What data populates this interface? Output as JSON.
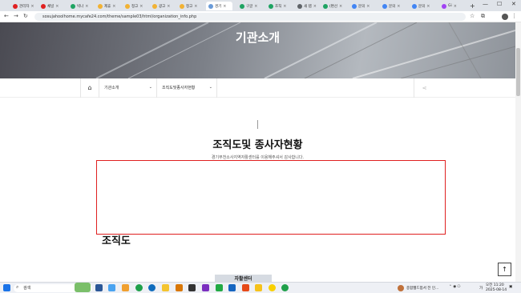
{
  "tabs": [
    {
      "label": "관리자",
      "color": "#e02020"
    },
    {
      "label": "채널",
      "color": "#e02020"
    },
    {
      "label": "빅나",
      "color": "#1ea362"
    },
    {
      "label": "제휴",
      "color": "#f2b233"
    },
    {
      "label": "정고",
      "color": "#f2b233"
    },
    {
      "label": "광고",
      "color": "#f2b233"
    },
    {
      "label": "정고",
      "color": "#f2b233"
    },
    {
      "label": "경기",
      "color": "#6a9bd8"
    },
    {
      "label": "구글",
      "color": "#1ea362"
    },
    {
      "label": "조직",
      "color": "#1ea362"
    },
    {
      "label": "새 탭",
      "color": "#5f6368"
    },
    {
      "label": "(편선",
      "color": "#1ea362"
    },
    {
      "label": "문의",
      "color": "#4285f4"
    },
    {
      "label": "문의",
      "color": "#4285f4"
    },
    {
      "label": "문의",
      "color": "#4285f4"
    },
    {
      "label": "Gi",
      "color": "#a142f4"
    }
  ],
  "new_tab": "+",
  "window": {
    "minimize": "—",
    "maximize": "☐",
    "close": "✕"
  },
  "address": {
    "url": "sosujahoolhome.mycafe24.com/theme/sample03/html/organization_info.php"
  },
  "hero": {
    "title": "기관소개"
  },
  "breadcrumb": {
    "home": "⌂",
    "level1": "기관소개",
    "level2": "조직도및종사자현황",
    "chevron": "⌄"
  },
  "section": {
    "title": "조직도및 종사자현황",
    "subtitle": "경기부천소사지역자활센터를 이용해주셔서 감사합니다."
  },
  "org": {
    "title": "조직도"
  },
  "bottom_tab": "자활센터",
  "scroll_top": "↑",
  "taskbar": {
    "search": "검색",
    "weather": "종합웹드접서 전 인...",
    "time": "오전 11:20",
    "date": "2025-08-14",
    "lang": "가"
  },
  "colors": {
    "accent": "#e02020"
  }
}
